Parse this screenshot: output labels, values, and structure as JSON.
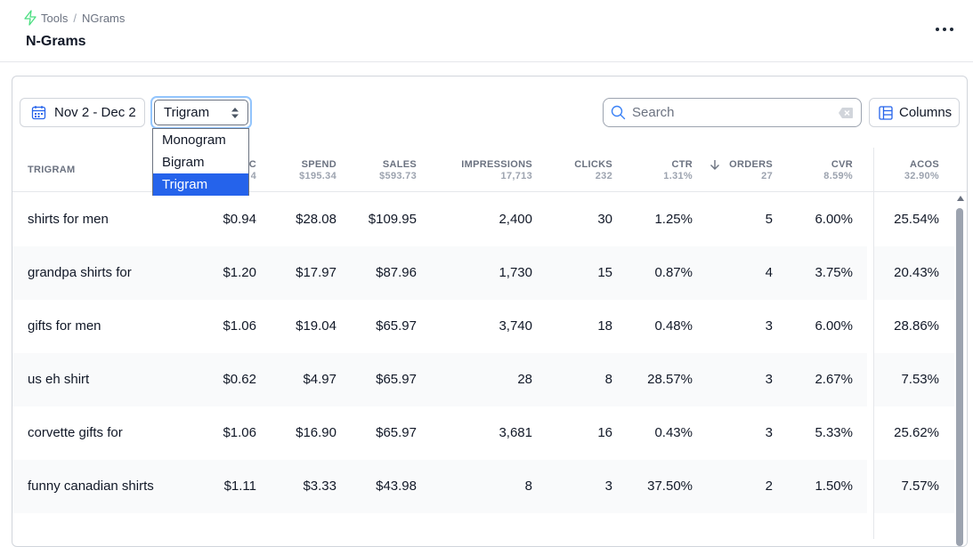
{
  "breadcrumb": {
    "root": "Tools",
    "separator": "/",
    "current": "NGrams"
  },
  "page": {
    "title": "N-Grams"
  },
  "toolbar": {
    "date_range": "Nov 2 - Dec 2",
    "ngram_select": {
      "value": "Trigram",
      "options": [
        "Monogram",
        "Bigram",
        "Trigram"
      ]
    },
    "search_placeholder": "Search",
    "columns_label": "Columns"
  },
  "table": {
    "headers": {
      "trigram": {
        "label": "TRIGRAM"
      },
      "cpc": {
        "label": "C",
        "total": "4"
      },
      "spend": {
        "label": "SPEND",
        "total": "$195.34"
      },
      "sales": {
        "label": "SALES",
        "total": "$593.73"
      },
      "impressions": {
        "label": "IMPRESSIONS",
        "total": "17,713"
      },
      "clicks": {
        "label": "CLICKS",
        "total": "232"
      },
      "ctr": {
        "label": "CTR",
        "total": "1.31%"
      },
      "orders": {
        "label": "ORDERS",
        "total": "27"
      },
      "cvr": {
        "label": "CVR",
        "total": "8.59%"
      },
      "acos": {
        "label": "ACOS",
        "total": "32.90%"
      }
    },
    "rows": [
      {
        "term": "shirts for men",
        "cpc": "$0.94",
        "spend": "$28.08",
        "sales": "$109.95",
        "impressions": "2,400",
        "clicks": "30",
        "ctr": "1.25%",
        "orders": "5",
        "cvr": "6.00%",
        "acos": "25.54%"
      },
      {
        "term": "grandpa shirts for",
        "cpc": "$1.20",
        "spend": "$17.97",
        "sales": "$87.96",
        "impressions": "1,730",
        "clicks": "15",
        "ctr": "0.87%",
        "orders": "4",
        "cvr": "3.75%",
        "acos": "20.43%"
      },
      {
        "term": "gifts for men",
        "cpc": "$1.06",
        "spend": "$19.04",
        "sales": "$65.97",
        "impressions": "3,740",
        "clicks": "18",
        "ctr": "0.48%",
        "orders": "3",
        "cvr": "6.00%",
        "acos": "28.86%"
      },
      {
        "term": "us eh shirt",
        "cpc": "$0.62",
        "spend": "$4.97",
        "sales": "$65.97",
        "impressions": "28",
        "clicks": "8",
        "ctr": "28.57%",
        "orders": "3",
        "cvr": "2.67%",
        "acos": "7.53%"
      },
      {
        "term": "corvette gifts for",
        "cpc": "$1.06",
        "spend": "$16.90",
        "sales": "$65.97",
        "impressions": "3,681",
        "clicks": "16",
        "ctr": "0.43%",
        "orders": "3",
        "cvr": "5.33%",
        "acos": "25.62%"
      },
      {
        "term": "funny canadian shirts",
        "cpc": "$1.11",
        "spend": "$3.33",
        "sales": "$43.98",
        "impressions": "8",
        "clicks": "3",
        "ctr": "37.50%",
        "orders": "2",
        "cvr": "1.50%",
        "acos": "7.57%"
      }
    ]
  },
  "colors": {
    "accent": "#2563eb",
    "focus_ring": "#93c5fd",
    "logo": "#4ade80",
    "row_alt": "#f9fafb"
  },
  "icons": {
    "logo": "bolt-icon",
    "more": "ellipsis-icon",
    "date": "calendar-icon",
    "select": "sort-arrows-icon",
    "search": "search-icon",
    "clear": "clear-input-icon",
    "columns": "columns-icon",
    "sort": "arrow-down-icon"
  }
}
